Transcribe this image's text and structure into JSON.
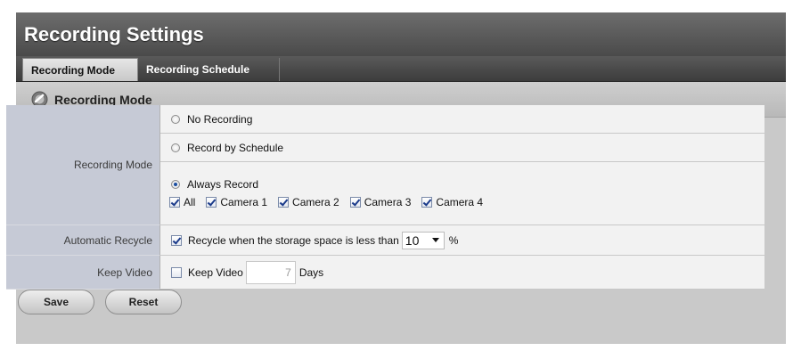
{
  "title": "Recording Settings",
  "tabs": [
    {
      "label": "Recording Mode",
      "active": true
    },
    {
      "label": "Recording Schedule",
      "active": false
    }
  ],
  "section": {
    "title": "Recording Mode",
    "icon": "recording-mode-icon"
  },
  "recording_mode": {
    "label": "Recording Mode",
    "options": [
      {
        "label": "No Recording",
        "checked": false
      },
      {
        "label": "Record by Schedule",
        "checked": false
      },
      {
        "label": "Always Record",
        "checked": true
      }
    ],
    "cameras": [
      {
        "label": "All",
        "checked": true
      },
      {
        "label": "Camera 1",
        "checked": true
      },
      {
        "label": "Camera 2",
        "checked": true
      },
      {
        "label": "Camera 3",
        "checked": true
      },
      {
        "label": "Camera 4",
        "checked": true
      }
    ]
  },
  "automatic_recycle": {
    "label": "Automatic Recycle",
    "checkbox_label": "Recycle when the storage space is less than",
    "checked": true,
    "threshold_value": "10",
    "unit": "%"
  },
  "keep_video": {
    "label": "Keep Video",
    "checkbox_label": "Keep Video",
    "checked": false,
    "days_value": "7",
    "days_unit": "Days"
  },
  "buttons": {
    "save": "Save",
    "reset": "Reset"
  },
  "colors": {
    "title_bar": "#5a5a5a",
    "label_bg": "#c6cad6",
    "value_bg": "#f2f2f2",
    "radio_dot": "#1a4da0"
  }
}
